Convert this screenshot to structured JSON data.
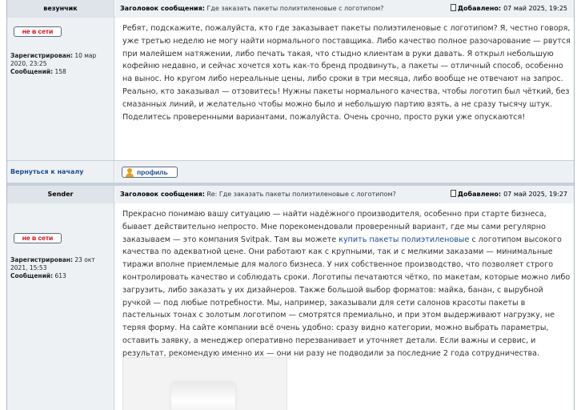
{
  "post1": {
    "author": "везунчик",
    "subject_label": "Заголовок сообщения:",
    "subject": "Где заказать пакеты полиэтиленовые с логотипом?",
    "posted_label": "Добавлено:",
    "posted_date": "07 май 2025, 19:25",
    "status": "не в сети",
    "registered_label": "Зарегистрирован:",
    "registered": "10 мар 2020, 23:25",
    "posts_label": "Сообщений:",
    "posts": "158",
    "body": "Ребят, подскажите, пожалуйста, кто где заказывает пакеты полиэтиленовые с логотипом? Я, честно говоря, уже третью неделю не могу найти нормального поставщика. Либо качество полное разочарование — рвутся при малейшем натяжении, либо печать такая, что стыдно клиентам в руки давать. Я открыл небольшую кофейню недавно, и сейчас хочется хоть как-то бренд продвинуть, а пакеты — отличный способ, особенно на вынос. Но кругом либо нереальные цены, либо сроки в три месяца, либо вообще не отвечают на запрос. Реально, кто заказывал — отзовитесь! Нужны пакеты нормального качества, чтобы логотип был чёткий, без смазанных линий, и желательно чтобы можно было и небольшую партию взять, а не сразу тысячу штук. Поделитесь проверенными вариантами, пожалуйста. Очень срочно, просто руки уже опускаются!",
    "back_to_top": "Вернуться к началу",
    "profile": "профиль"
  },
  "post2": {
    "author": "Sender",
    "subject_label": "Заголовок сообщения:",
    "subject": "Re: Где заказать пакеты полиэтиленовые с логотипом?",
    "posted_label": "Добавлено:",
    "posted_date": "07 май 2025, 19:27",
    "status": "не в сети",
    "registered_label": "Зарегистрирован:",
    "registered": "23 окт 2021, 15:53",
    "posts_label": "Сообщений:",
    "posts": "613",
    "body_before_link": "Прекрасно понимаю вашу ситуацию — найти надёжного производителя, особенно при старте бизнеса, бывает действительно непросто. Мне порекомендовали проверенный вариант, где мы сами регулярно заказываем — это компания Svitpak. Там вы можете ",
    "link_text": "купить пакеты полиэтиленовые",
    "body_after_link": " с логотипом высокого качества по адекватной цене. Они работают как с крупными, так и с мелкими заказами — минимальные тиражи вполне приемлемые для малого бизнеса. У них собственное производство, что позволяет строго контролировать качество и соблюдать сроки. Логотипы печатаются чётко, по макетам, которые можно либо загрузить, либо заказать у их дизайнеров. Также большой выбор форматов: майка, банан, с вырубной ручкой — под любые потребности. Мы, например, заказывали для сети салонов красоты пакеты в пастельных тонах с золотым логотипом — смотрятся премиально, и при этом выдерживают нагрузку, не теряя форму. На сайте компании всё очень удобно: сразу видно категории, можно выбрать параметры, оставить заявку, а менеджер оперативно перезванивает и уточняет детали. Если важны и сервис, и результат, рекомендую именно их — они ни разу не подводили за последние 2 года сотрудничества."
  }
}
